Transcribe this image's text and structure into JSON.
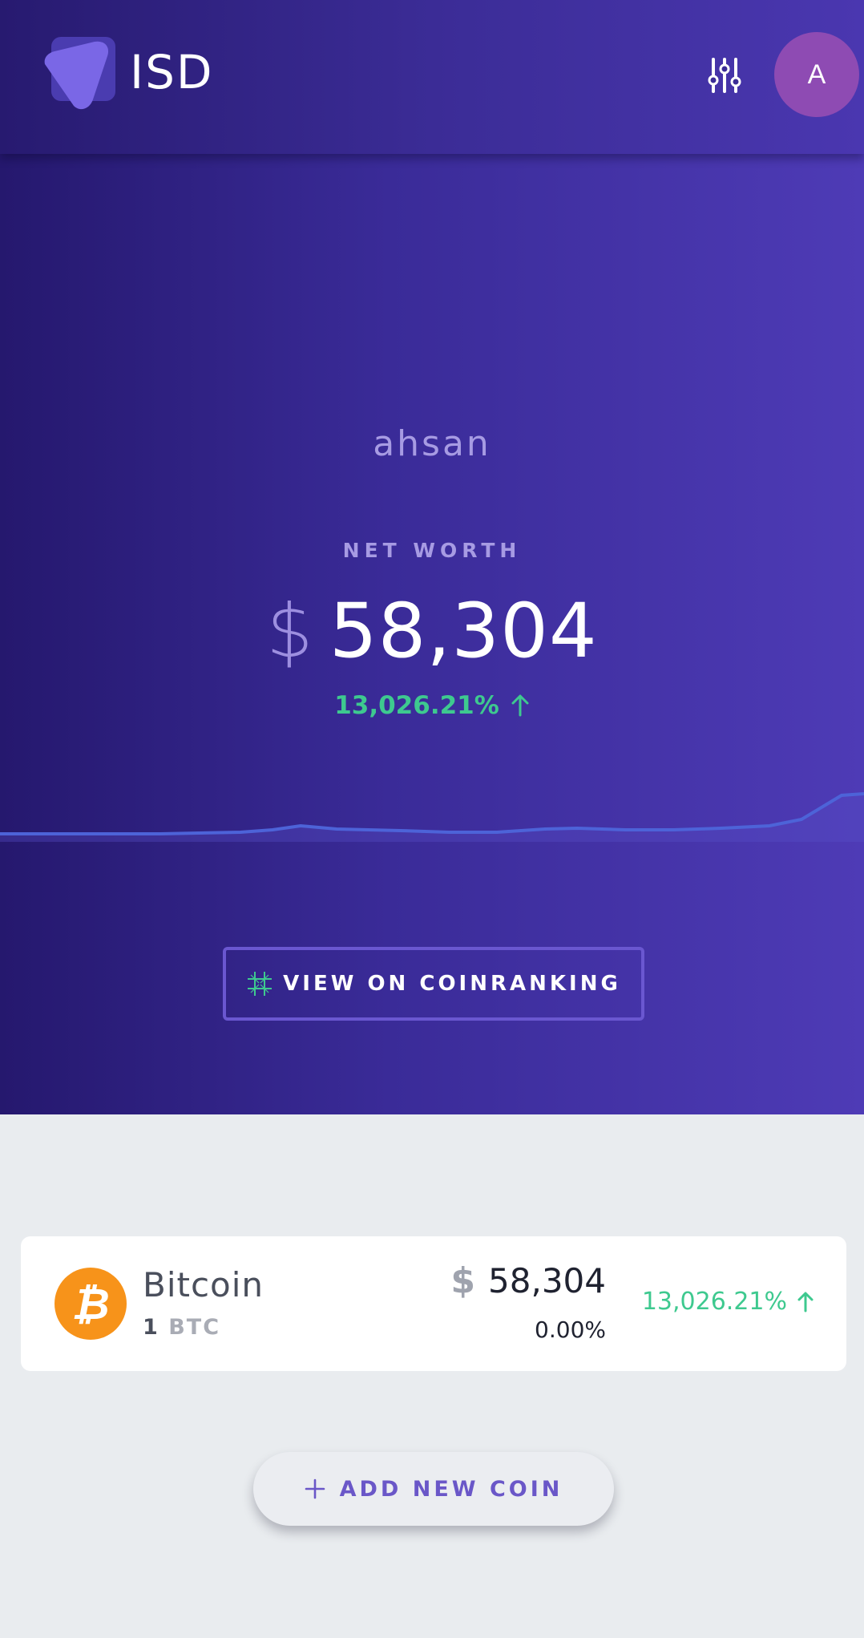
{
  "header": {
    "app_name": "ISD",
    "avatar_initial": "A"
  },
  "portfolio": {
    "username": "ahsan",
    "net_worth_label": "NET WORTH",
    "currency_symbol": "$",
    "net_worth_value": "58,304",
    "change_percent": "13,026.21%",
    "change_direction": "up",
    "coinranking_button": "VIEW ON COINRANKING"
  },
  "coins": [
    {
      "name": "Bitcoin",
      "quantity": "1",
      "symbol": "BTC",
      "currency_symbol": "$",
      "value": "58,304",
      "price_change": "0.00%",
      "total_change": "13,026.21%",
      "total_change_direction": "up"
    }
  ],
  "actions": {
    "add_coin_label": "ADD NEW COIN"
  },
  "colors": {
    "accent": "#4e3bb6",
    "positive": "#3ec98f",
    "bitcoin": "#f7931a",
    "avatar": "#8e4bb3"
  }
}
